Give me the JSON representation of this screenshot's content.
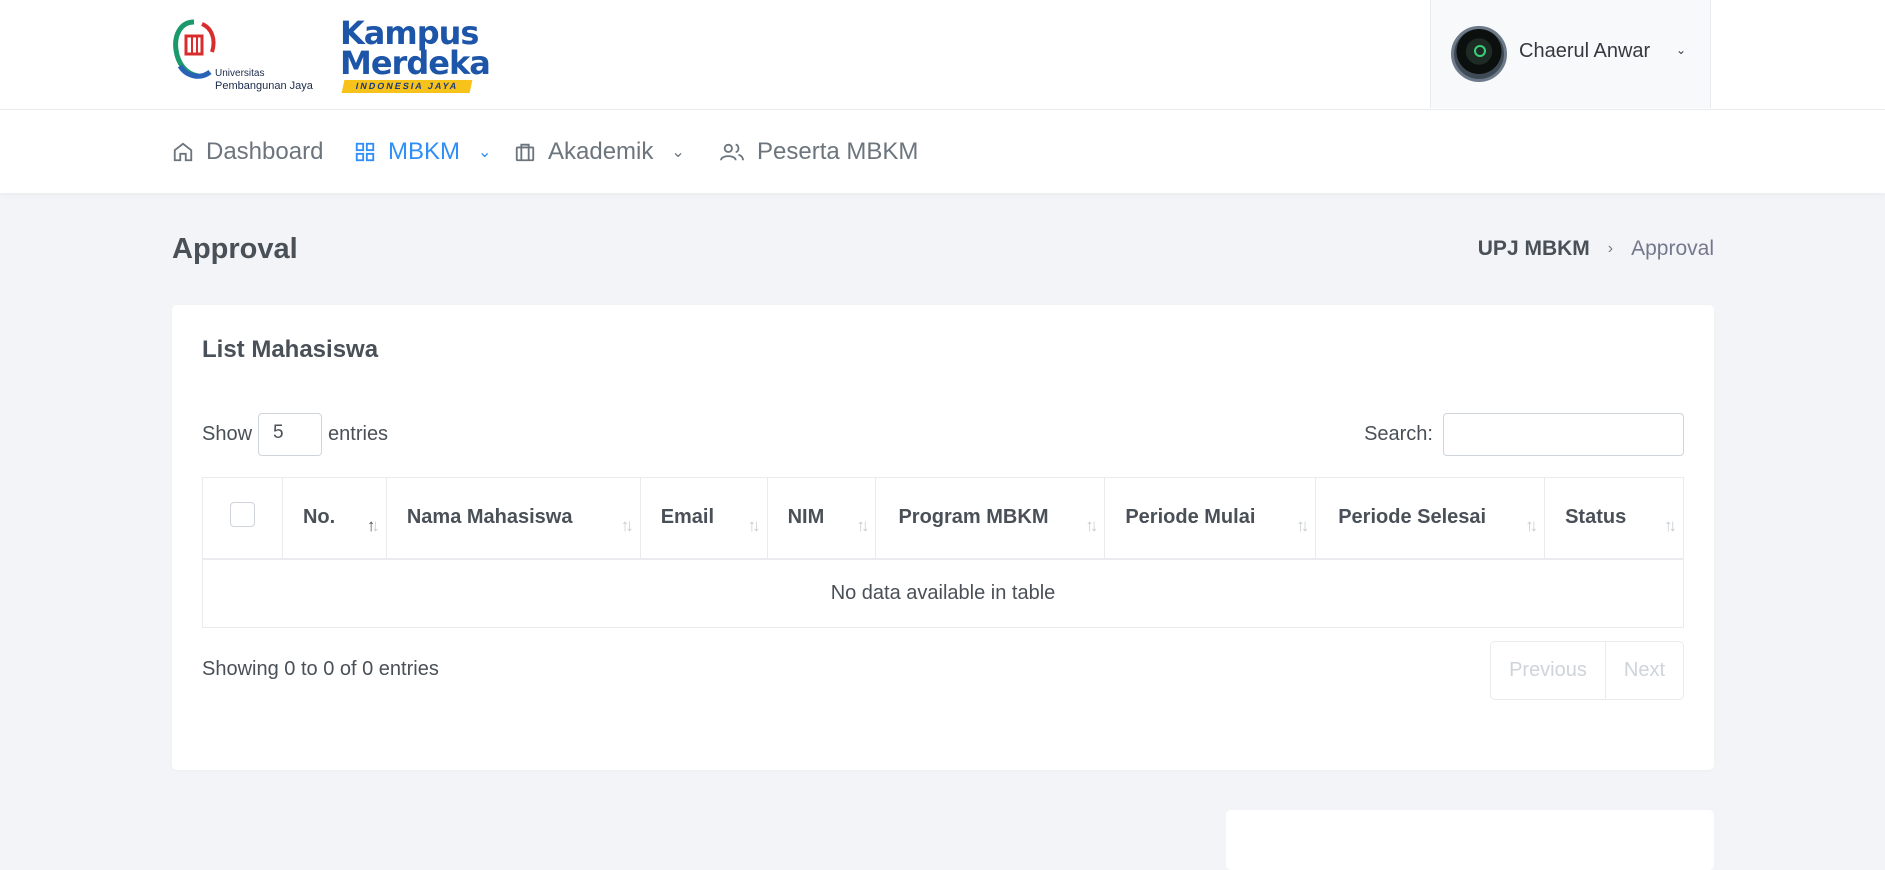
{
  "header": {
    "logo_upj_line1": "Universitas",
    "logo_upj_line2": "Pembangunan Jaya",
    "logo_km_line1": "Kampus",
    "logo_km_line2": "Merdeka",
    "logo_km_line3": "INDONESIA JAYA",
    "user_name": "Chaerul Anwar",
    "user_chevron_icon": "chevron-down-icon"
  },
  "nav": {
    "items": [
      {
        "label": "Dashboard",
        "icon": "home-icon"
      },
      {
        "label": "MBKM",
        "icon": "grid-icon",
        "active": true,
        "dropdown": true
      },
      {
        "label": "Akademik",
        "icon": "briefcase-icon",
        "dropdown": true
      },
      {
        "label": "Peserta MBKM",
        "icon": "users-icon"
      }
    ]
  },
  "page": {
    "title": "Approval",
    "breadcrumb": [
      "UPJ MBKM",
      "Approval"
    ]
  },
  "card": {
    "title": "List Mahasiswa",
    "show_label": "Show",
    "entries_value": "5",
    "entries_label": "entries",
    "search_label": "Search:",
    "search_value": "",
    "columns": [
      "No.",
      "Nama Mahasiswa",
      "Email",
      "NIM",
      "Program MBKM",
      "Periode Mulai",
      "Periode Selesai",
      "Status"
    ],
    "empty_message": "No data available in table",
    "info": "Showing 0 to 0 of 0 entries",
    "prev_label": "Previous",
    "next_label": "Next"
  },
  "colors": {
    "accent": "#2f8ef7",
    "background": "#f3f4f7",
    "text": "#495057"
  }
}
